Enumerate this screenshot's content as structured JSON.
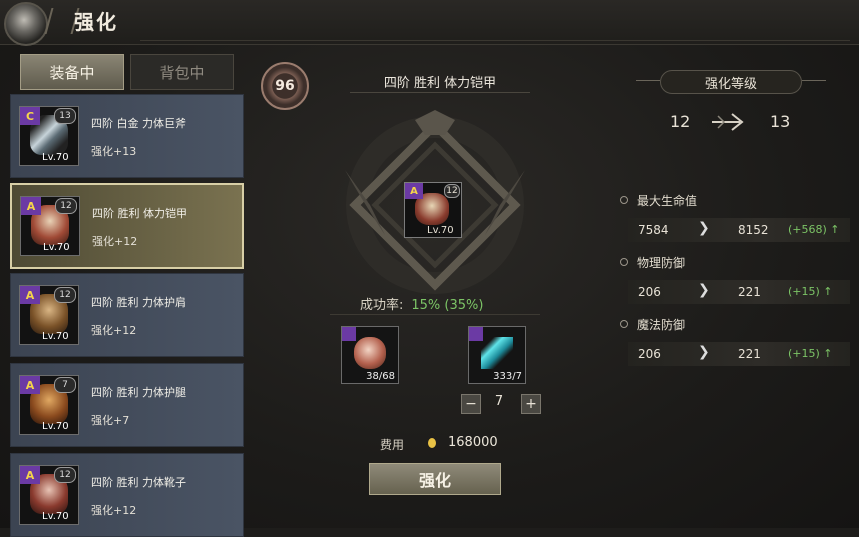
{
  "header": {
    "title": "强化"
  },
  "tabs": [
    {
      "label": "装备中",
      "active": true
    },
    {
      "label": "背包中",
      "active": false
    }
  ],
  "equipment_list": [
    {
      "name": "四阶 白金 力体巨斧",
      "enhance": "强化+13",
      "level": "Lv.70",
      "plus": "13",
      "grade": "C",
      "color": "#8fb0c0"
    },
    {
      "name": "四阶 胜利 体力铠甲",
      "enhance": "强化+12",
      "level": "Lv.70",
      "plus": "12",
      "grade": "A",
      "color": "#b05a42"
    },
    {
      "name": "四阶 胜利 力体护肩",
      "enhance": "强化+12",
      "level": "Lv.70",
      "plus": "12",
      "grade": "A",
      "color": "#8a6a3a"
    },
    {
      "name": "四阶 胜利 力体护腿",
      "enhance": "强化+7",
      "level": "Lv.70",
      "plus": "7",
      "grade": "A",
      "color": "#9a5a2e"
    },
    {
      "name": "四阶 胜利 力体靴子",
      "enhance": "强化+12",
      "level": "Lv.70",
      "plus": "12",
      "grade": "A",
      "color": "#b08a7a"
    }
  ],
  "center": {
    "score_badge": "96",
    "item_name": "四阶 胜利 体力铠甲",
    "item": {
      "grade": "A",
      "plus": "12",
      "level": "Lv.70"
    },
    "success_label": "成功率:",
    "success_value": "15% (35%)",
    "materials": [
      {
        "count": "38/68"
      },
      {
        "count": "333/7"
      }
    ],
    "stepper_value": "7",
    "stepper_minus": "−",
    "stepper_plus": "+",
    "cost_label": "费用",
    "cost_value": "168000",
    "action_label": "强化"
  },
  "enhance_level": {
    "header": "强化等级",
    "from": "12",
    "to": "13"
  },
  "stats": [
    {
      "name": "最大生命值",
      "old": "7584",
      "new": "8152",
      "diff": "(+568)"
    },
    {
      "name": "物理防御",
      "old": "206",
      "new": "221",
      "diff": "(+15)"
    },
    {
      "name": "魔法防御",
      "old": "206",
      "new": "221",
      "diff": "(+15)"
    }
  ],
  "colors": {
    "success_green": "#7cc466",
    "selected_gold": "#d8cfa6",
    "grade_purple": "#6b3aa4"
  }
}
